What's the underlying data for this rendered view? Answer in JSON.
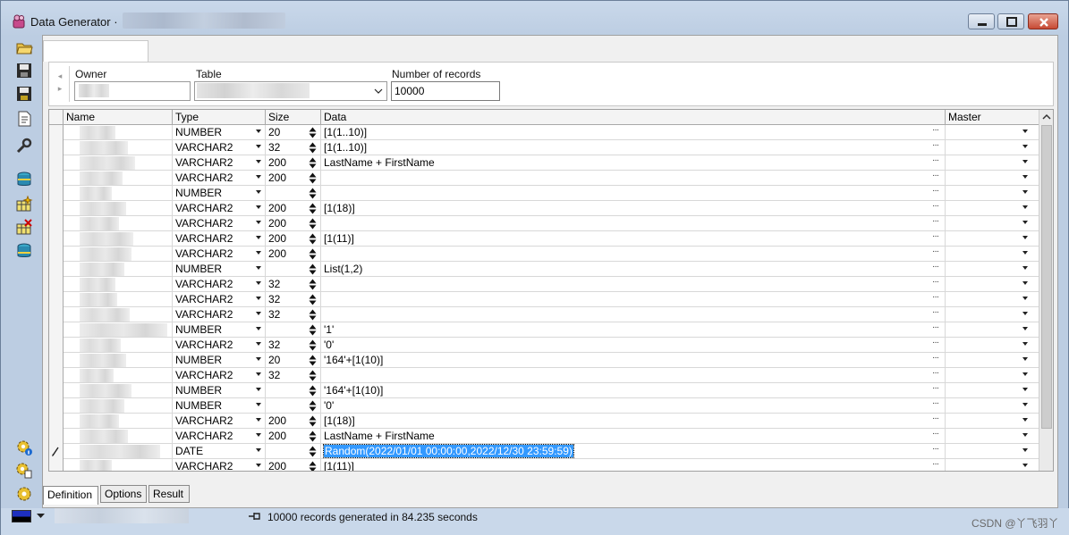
{
  "window": {
    "title": "Data Generator ·"
  },
  "header": {
    "owner_label": "Owner",
    "table_label": "Table",
    "records_label": "Number of records",
    "records_value": "10000"
  },
  "grid": {
    "columns": [
      "Name",
      "Type",
      "Size",
      "Data",
      "Master"
    ],
    "rows": [
      {
        "type": "NUMBER",
        "size": "20",
        "data": "[1(1..10)]"
      },
      {
        "type": "VARCHAR2",
        "size": "32",
        "data": "[1(1..10)]"
      },
      {
        "type": "VARCHAR2",
        "size": "200",
        "data": "LastName + FirstName"
      },
      {
        "type": "VARCHAR2",
        "size": "200",
        "data": ""
      },
      {
        "type": "NUMBER",
        "size": "",
        "data": ""
      },
      {
        "type": "VARCHAR2",
        "size": "200",
        "data": "[1(18)]"
      },
      {
        "type": "VARCHAR2",
        "size": "200",
        "data": ""
      },
      {
        "type": "VARCHAR2",
        "size": "200",
        "data": "[1(11)]"
      },
      {
        "type": "VARCHAR2",
        "size": "200",
        "data": ""
      },
      {
        "type": "NUMBER",
        "size": "",
        "data": "List(1,2)"
      },
      {
        "type": "VARCHAR2",
        "size": "32",
        "data": ""
      },
      {
        "type": "VARCHAR2",
        "size": "32",
        "data": ""
      },
      {
        "type": "VARCHAR2",
        "size": "32",
        "data": ""
      },
      {
        "type": "NUMBER",
        "size": "",
        "data": "'1'"
      },
      {
        "type": "VARCHAR2",
        "size": "32",
        "data": "'0'"
      },
      {
        "type": "NUMBER",
        "size": "20",
        "data": "'164'+[1(10)]"
      },
      {
        "type": "VARCHAR2",
        "size": "32",
        "data": ""
      },
      {
        "type": "NUMBER",
        "size": "",
        "data": "'164'+[1(10)]"
      },
      {
        "type": "NUMBER",
        "size": "",
        "data": "'0'"
      },
      {
        "type": "VARCHAR2",
        "size": "200",
        "data": "[1(18)]"
      },
      {
        "type": "VARCHAR2",
        "size": "200",
        "data": "LastName + FirstName"
      },
      {
        "type": "DATE",
        "size": "",
        "data": "Random(2022/01/01 00:00:00,2022/12/30 23:59:59)",
        "selected": true,
        "editing": true
      },
      {
        "type": "VARCHAR2",
        "size": "200",
        "data": "[1(11)]"
      }
    ]
  },
  "tabs": {
    "definition": "Definition",
    "options": "Options",
    "result": "Result"
  },
  "status": {
    "message": "10000 records generated in 84.235 seconds"
  },
  "watermark": "CSDN @丫飞羽丫",
  "colors": {
    "selection": "#3399ff",
    "close_button": "#c74a34"
  }
}
